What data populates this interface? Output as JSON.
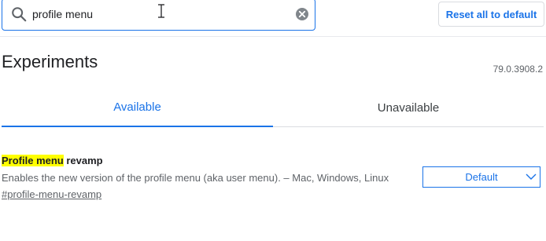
{
  "search": {
    "value": "profile menu",
    "icon": "search-icon",
    "clear_icon": "clear-icon"
  },
  "toolbar": {
    "reset_label": "Reset all to default"
  },
  "header": {
    "title": "Experiments",
    "version": "79.0.3908.2"
  },
  "tabs": [
    {
      "label": "Available",
      "active": true
    },
    {
      "label": "Unavailable",
      "active": false
    }
  ],
  "experiments": [
    {
      "title_highlight": "Profile menu",
      "title_rest": " revamp",
      "description": "Enables the new version of the profile menu (aka user menu). – Mac, Windows, Linux",
      "link": "#profile-menu-revamp",
      "selected_option": "Default"
    }
  ],
  "colors": {
    "accent": "#1a73e8",
    "highlight": "#ffff00",
    "secondary_text": "#5f6368"
  }
}
